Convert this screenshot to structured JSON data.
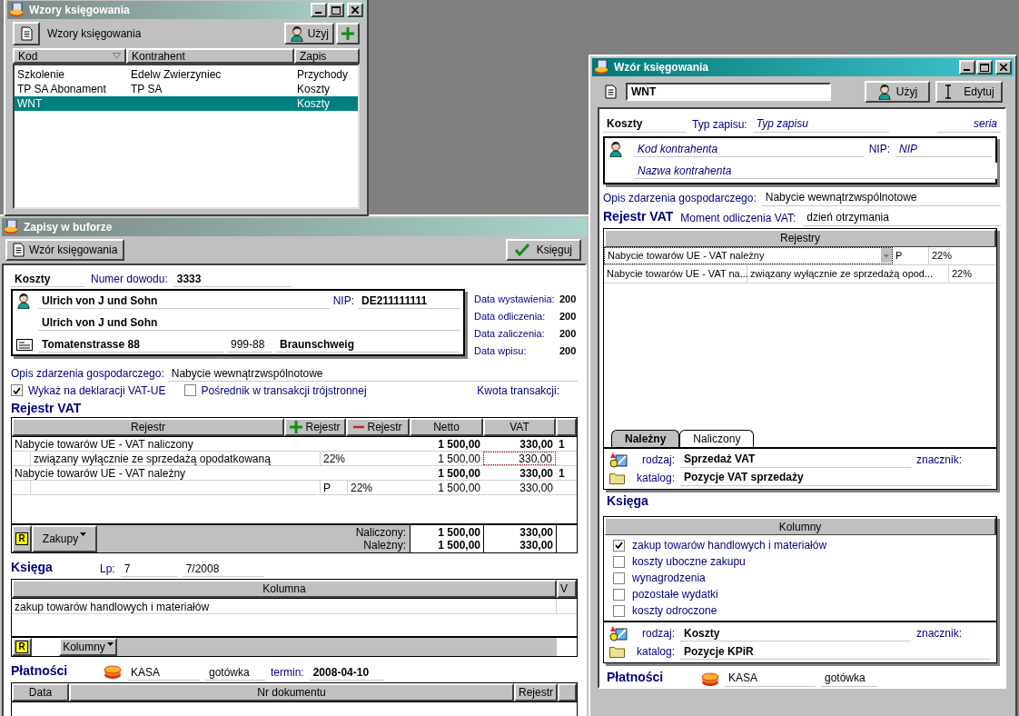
{
  "patterns_window": {
    "title": "Wzory księgowania",
    "active": false,
    "toolbar_label": "Wzory księgowania",
    "use_button": "Użyj",
    "columns": [
      "Kod",
      "Kontrahent",
      "Zapis"
    ],
    "rows": [
      {
        "kod": "Szkolenie",
        "kontrahent": "Edelw Zwierzyniec",
        "zapis": "Przychody",
        "selected": false
      },
      {
        "kod": "TP SA Abonament",
        "kontrahent": "TP SA",
        "zapis": "Koszty",
        "selected": false
      },
      {
        "kod": "WNT",
        "zapis": "Koszty",
        "selected": true
      }
    ]
  },
  "buffer_window": {
    "title": "Zapisy w buforze",
    "active": false,
    "pattern_button": "Wzór księgowania",
    "post_button": "Księguj",
    "record_type": "Koszty",
    "document_number_label": "Numer dowodu:",
    "document_number": "3333",
    "contractor": {
      "name": "Ulrich von J und Sohn",
      "nip_label": "NIP:",
      "nip": "DE211111111",
      "full_name": "Ulrich von J und Sohn",
      "street": "Tomatenstrasse 88",
      "postal_code": "999-88",
      "city": "Braunschweig"
    },
    "dates": [
      {
        "label": "Data wystawienia:",
        "value": "200"
      },
      {
        "label": "Data odliczenia:",
        "value": "200"
      },
      {
        "label": "Data zaliczenia:",
        "value": "200"
      },
      {
        "label": "Data wpisu:",
        "value": "200"
      }
    ],
    "description_label": "Opis zdarzenia gospodarczego:",
    "description": "Nabycie wewnątrzwspólnotowe",
    "checkboxes": [
      {
        "label": "Wykaż na deklaracji VAT-UE",
        "checked": true
      },
      {
        "label": "Pośrednik w transakcji trójstronnej",
        "checked": false
      }
    ],
    "amount_label": "Kwota transakcji:",
    "vat_heading": "Rejestr VAT",
    "vat_table": {
      "columns": [
        "Rejestr",
        "Netto",
        "VAT"
      ],
      "add_button": "Rejestr",
      "remove_button": "Rejestr",
      "rows": [
        {
          "kind": "group",
          "name": "Nabycie towarów UE - VAT naliczony",
          "netto": "1 500,00",
          "vat": "330,00",
          "column_3": "1"
        },
        {
          "kind": "detail",
          "name": "związany wyłącznie ze sprzedażą opodatkowaną",
          "rate": "22%",
          "netto": "1 500,00",
          "vat": "330,00",
          "focused": true
        },
        {
          "kind": "group",
          "name": "Nabycie towarów UE - VAT należny",
          "netto": "1 500,00",
          "vat": "330,00",
          "column_3": "1"
        },
        {
          "kind": "detail",
          "flag": "P",
          "rate": "22%",
          "netto": "1 500,00",
          "vat": "330,00",
          "focused": false
        }
      ],
      "badge": "R",
      "menu_button": "Zakupy",
      "totals": [
        {
          "label": "Naliczony:",
          "netto": "1 500,00",
          "vat": "330,00"
        },
        {
          "label": "Należny:",
          "netto": "1 500,00",
          "vat": "330,00"
        }
      ]
    },
    "ledger": {
      "heading": "Księga",
      "lp_label": "Lp:",
      "lp": "7",
      "number": "7/2008",
      "columns": [
        "Kolumna",
        "V"
      ],
      "rows": [
        "zakup towarów handlowych i materiałów"
      ],
      "badge": "R",
      "menu_button": "Kolumny"
    },
    "payments": {
      "heading": "Płatności",
      "cashbox": "KASA",
      "method": "gotówka",
      "due_label": "termin:",
      "due": "2008-04-10",
      "columns": [
        "Data",
        "Nr dokumentu",
        "Rejestr"
      ]
    }
  },
  "pattern_window": {
    "title": "Wzór księgowania",
    "active": true,
    "name": "WNT",
    "use_button": "Użyj",
    "edit_button": "Edytuj",
    "record_type": "Koszty",
    "type_label": "Typ zapisu:",
    "type_field": {
      "placeholder": "Typ zapisu"
    },
    "series_field": {
      "placeholder": "seria"
    },
    "contractor_code_field": {
      "placeholder": "Kod kontrahenta"
    },
    "nip_label": "NIP:",
    "nip_field": {
      "placeholder": "NIP"
    },
    "contractor_name_field": {
      "placeholder": "Nazwa kontrahenta"
    },
    "description_label": "Opis zdarzenia gospodarczego:",
    "description": "Nabycie wewnątrzwspólnotowe",
    "vat_heading": "Rejestr VAT",
    "moment_label": "Moment odliczenia VAT:",
    "moment": "dzień otrzymania",
    "registers": {
      "column": "Rejestry",
      "rows": [
        {
          "kind": "dropdown",
          "name": "Nabycie towarów UE - VAT należny",
          "flag": "P",
          "rate": "22%"
        },
        {
          "kind": "plain",
          "name": "Nabycie towarów UE - VAT na...",
          "detail": "związany wyłącznie ze sprzedażą opod...",
          "rate": "22%"
        }
      ]
    },
    "tabs": [
      {
        "label": "Należny",
        "selected": true
      },
      {
        "label": "Naliczony",
        "selected": false
      }
    ],
    "vat_fields": {
      "kind_label": "rodzaj:",
      "kind_value": "Sprzedaż VAT",
      "marker_label": "znacznik:",
      "catalog_label": "katalog:",
      "catalog": "Pozycje VAT sprzedaży"
    },
    "ledger_heading": "Księga",
    "columns_header": "Kolumny",
    "columns": [
      {
        "label": "zakup towarów handlowych i materiałów",
        "checked": true
      },
      {
        "label": "koszty uboczne zakupu",
        "checked": false
      },
      {
        "label": "wynagrodzenia",
        "checked": false
      },
      {
        "label": "pozostałe wydatki",
        "checked": false
      },
      {
        "label": "koszty odroczone",
        "checked": false
      }
    ],
    "ledger_fields": {
      "kind_label": "rodzaj:",
      "kind_value": "Koszty",
      "marker_label": "znacznik:",
      "catalog_label": "katalog:",
      "catalog": "Pozycje KPiR"
    },
    "payments": {
      "heading": "Płatności",
      "cashbox": "KASA",
      "method": "gotówka"
    }
  }
}
